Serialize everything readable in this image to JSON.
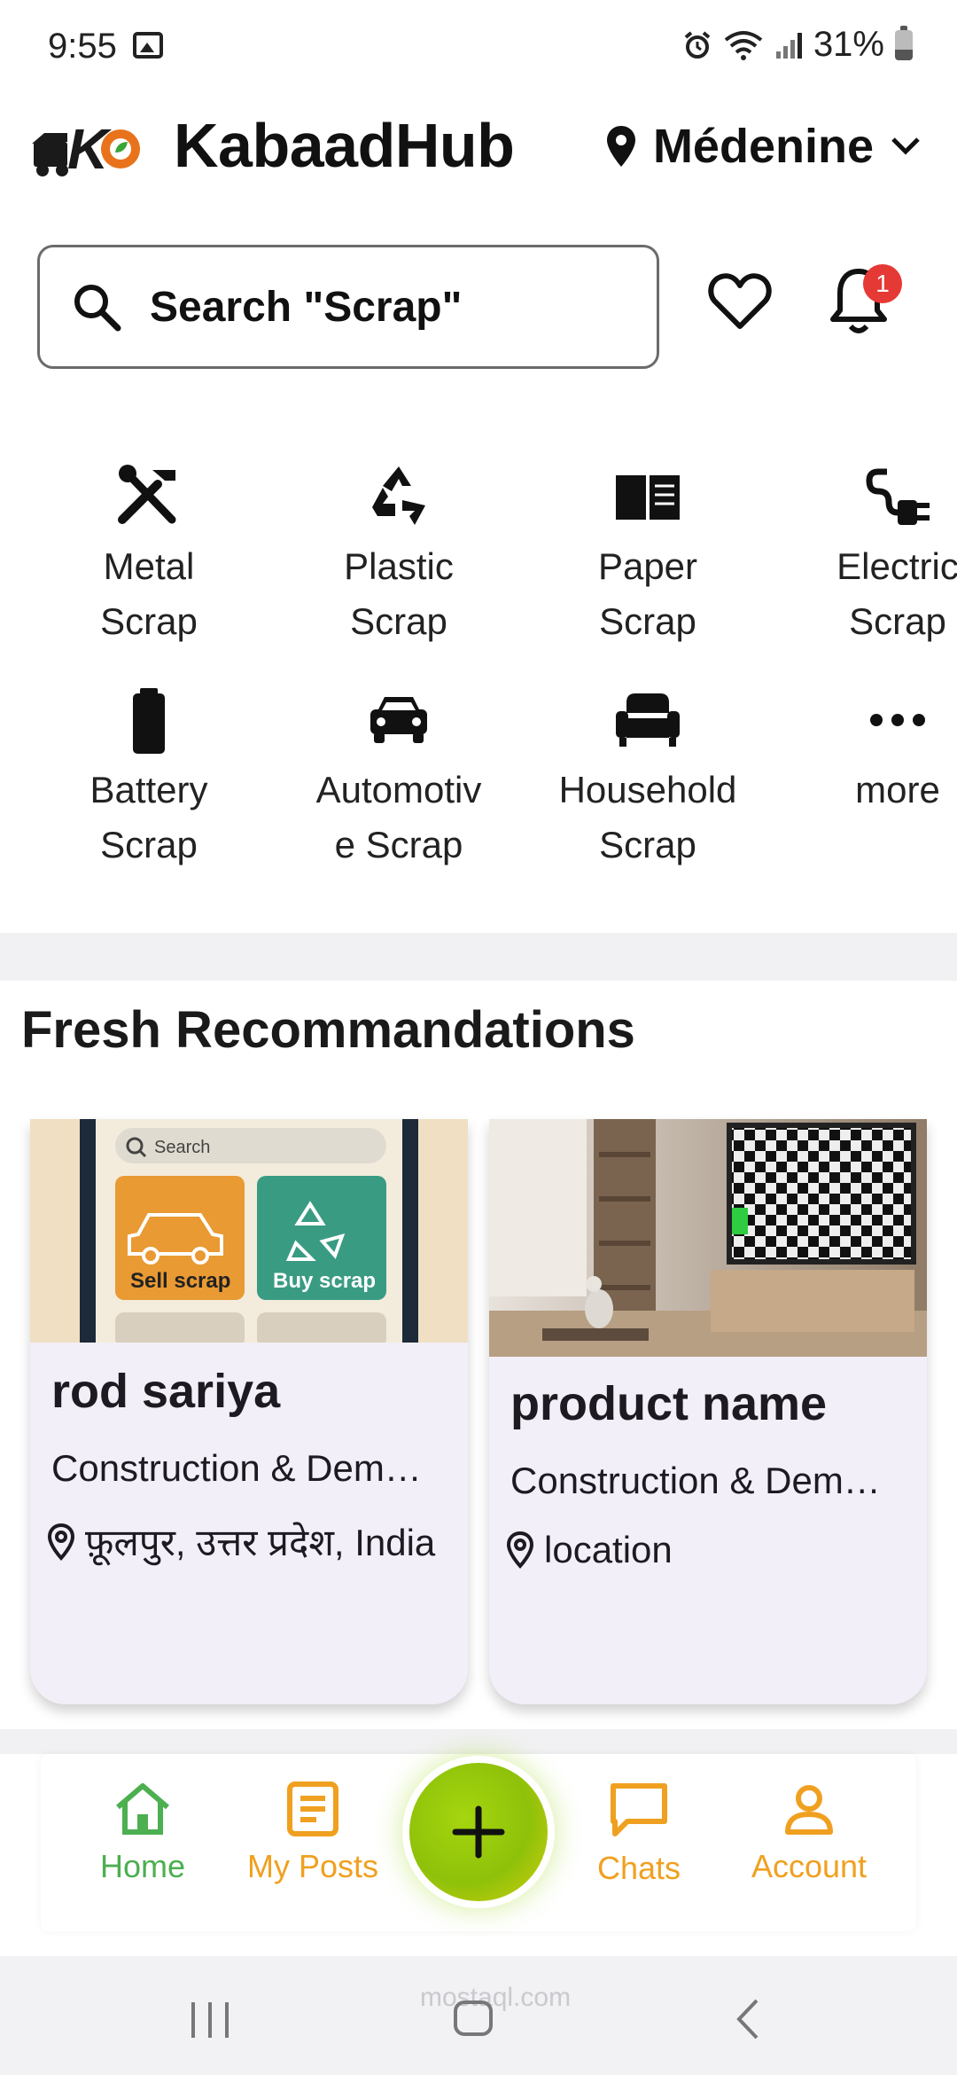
{
  "status_bar": {
    "time": "9:55",
    "battery": "31%"
  },
  "header": {
    "app_title": "KabaadHub",
    "location": "Médenine",
    "logo_letter": "K"
  },
  "search": {
    "placeholder": "Search \"Scrap\"",
    "notification_count": "1"
  },
  "categories": [
    {
      "label": "Metal\nScrap",
      "icon": "tools-icon"
    },
    {
      "label": "Plastic\nScrap",
      "icon": "recycle-icon"
    },
    {
      "label": "Paper\nScrap",
      "icon": "book-icon"
    },
    {
      "label": "Electric\nScrap",
      "icon": "plug-icon"
    },
    {
      "label": "Battery\nScrap",
      "icon": "battery-icon"
    },
    {
      "label": "Automotiv\ne Scrap",
      "icon": "car-icon"
    },
    {
      "label": "Household\nScrap",
      "icon": "sofa-icon"
    },
    {
      "label": "more",
      "icon": "more-icon"
    }
  ],
  "section": {
    "title": "Fresh Recommandations"
  },
  "products": [
    {
      "name": "rod sariya",
      "category": "Construction & Dem…",
      "location": "फ़ूलपुर, उत्तर प्रदेश, India",
      "image_search": "Search",
      "image_tile_1": "Sell scrap",
      "image_tile_2": "Buy scrap"
    },
    {
      "name": "product name",
      "category": "Construction & Dem…",
      "location": "location"
    }
  ],
  "bottom_nav": {
    "home": "Home",
    "my_posts": "My Posts",
    "chats": "Chats",
    "account": "Account"
  },
  "system": {
    "watermark": "mostaql.com"
  },
  "colors": {
    "home_active": "#4caf50",
    "nav_orange": "#f0a020",
    "fab_green": "#8ec10a",
    "badge_red": "#e53935",
    "card_bg": "#f3eff8"
  }
}
